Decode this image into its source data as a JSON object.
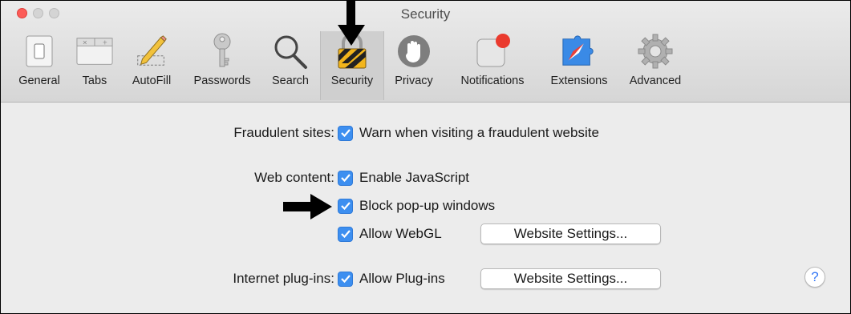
{
  "window": {
    "title": "Security"
  },
  "toolbar": {
    "items": [
      {
        "label": "General",
        "icon": "general-switch-icon"
      },
      {
        "label": "Tabs",
        "icon": "tabs-icon"
      },
      {
        "label": "AutoFill",
        "icon": "autofill-pencil-icon"
      },
      {
        "label": "Passwords",
        "icon": "key-icon"
      },
      {
        "label": "Search",
        "icon": "magnifier-icon"
      },
      {
        "label": "Security",
        "icon": "padlock-icon",
        "selected": true
      },
      {
        "label": "Privacy",
        "icon": "hand-icon"
      },
      {
        "label": "Notifications",
        "icon": "notification-badge-icon"
      },
      {
        "label": "Extensions",
        "icon": "puzzle-compass-icon"
      },
      {
        "label": "Advanced",
        "icon": "gear-icon"
      }
    ]
  },
  "security": {
    "fraudulent": {
      "label": "Fraudulent sites:",
      "option": "Warn when visiting a fraudulent website",
      "checked": true
    },
    "web_content": {
      "label": "Web content:",
      "javascript": "Enable JavaScript",
      "popups": "Block pop-up windows",
      "webgl": "Allow WebGL",
      "webgl_button": "Website Settings..."
    },
    "plugins": {
      "label": "Internet plug-ins:",
      "option": "Allow Plug-ins",
      "button": "Website Settings..."
    },
    "help": "?"
  },
  "colors": {
    "checkbox": "#3d8ff0",
    "close": "#fc5b57",
    "selected_tab": "#cfcfcf"
  }
}
